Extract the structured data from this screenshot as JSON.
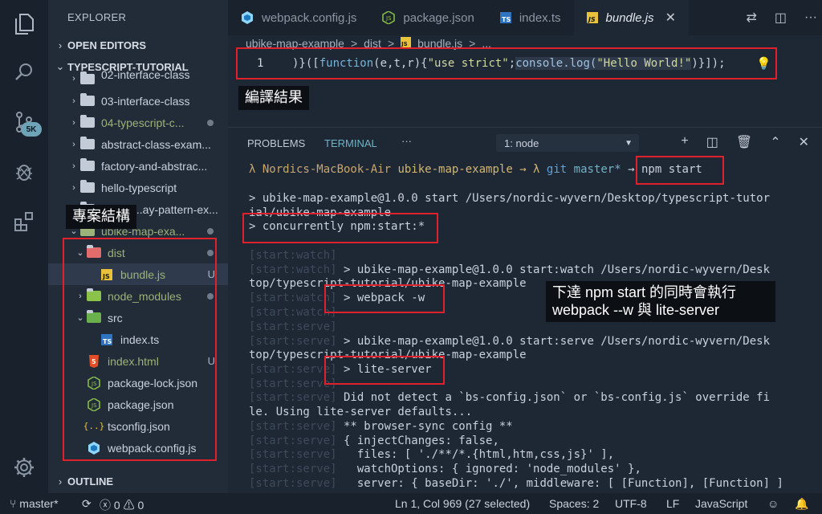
{
  "sidebar": {
    "title": "EXPLORER",
    "open_editors": "OPEN EDITORS",
    "project": "TYPESCRIPT-TUTORIAL",
    "outline": "OUTLINE",
    "items": [
      {
        "label": "02-interface-class"
      },
      {
        "label": "03-interface-class"
      },
      {
        "label": "04-typescript-c..."
      },
      {
        "label": "abstract-class-exam..."
      },
      {
        "label": "factory-and-abstrac..."
      },
      {
        "label": "hello-typescript"
      },
      {
        "label": "...ay-pattern-ex..."
      },
      {
        "label": "ubike-map-exa..."
      },
      {
        "label": "dist"
      },
      {
        "label": "bundle.js",
        "status": "U"
      },
      {
        "label": "node_modules"
      },
      {
        "label": "src"
      },
      {
        "label": "index.ts"
      },
      {
        "label": "index.html",
        "status": "U"
      },
      {
        "label": "package-lock.json"
      },
      {
        "label": "package.json"
      },
      {
        "label": "tsconfig.json"
      },
      {
        "label": "webpack.config.js"
      }
    ]
  },
  "activity": {
    "badge": "5K"
  },
  "tabs": [
    {
      "label": "webpack.config.js",
      "icon": "webpack-icon"
    },
    {
      "label": "package.json",
      "icon": "npm-icon"
    },
    {
      "label": "index.ts",
      "icon": "ts-icon"
    },
    {
      "label": "bundle.js",
      "icon": "js-icon"
    }
  ],
  "breadcrumb": {
    "folder": "ubike-map-example",
    "sep": ">",
    "dist": "dist",
    "file": "bundle.js",
    "more": "..."
  },
  "editor": {
    "line_number": "1",
    "code_prefix": ")}([",
    "code_kw": "function",
    "code_args": "(e,t,r){",
    "code_str": "\"use strict\"",
    "code_semi": ";",
    "code_console": "console.log(",
    "code_hello": "\"Hello World!\"",
    "code_tail": ")}]);"
  },
  "annotations": {
    "compile_result": "編譯結果",
    "project_structure": "專案結構",
    "npm_start_note_line1": "下達 npm start 的同時會執行",
    "npm_start_note_line2": "webpack --w 與 lite-server"
  },
  "panel": {
    "problems_tab": "PROBLEMS",
    "terminal_tab": "TERMINAL",
    "more": "···",
    "terminal_select": "1: node"
  },
  "terminal": {
    "prompt_host": "λ Nordics-MacBook-Air",
    "prompt_dir": "ubike-map-example",
    "prompt_arrow": "→ λ",
    "prompt_git": "git",
    "prompt_branch": "master*",
    "prompt_arrow2": "→",
    "prompt_cmd": "npm start",
    "lines": [
      {
        "prefix": "",
        "text": "> ubike-map-example@1.0.0 start /Users/nordic-wyvern/Desktop/typescript-tutor"
      },
      {
        "prefix": "",
        "text": "ial/ubike-map-example"
      },
      {
        "prefix": "",
        "text": "> concurrently npm:start:*"
      },
      {
        "prefix": "[start:watch]",
        "text": ""
      },
      {
        "prefix": "[start:watch]",
        "text": " > ubike-map-example@1.0.0 start:watch /Users/nordic-wyvern/Desk"
      },
      {
        "prefix": "",
        "text": "top/typescript-tutorial/ubike-map-example"
      },
      {
        "prefix": "[start:watch]",
        "text": " > webpack -w"
      },
      {
        "prefix": "[start:watch]",
        "text": ""
      },
      {
        "prefix": "[start:serve]",
        "text": ""
      },
      {
        "prefix": "[start:serve]",
        "text": " > ubike-map-example@1.0.0 start:serve /Users/nordic-wyvern/Desk"
      },
      {
        "prefix": "",
        "text": "top/typescript-tutorial/ubike-map-example"
      },
      {
        "prefix": "[start:serve]",
        "text": " > lite-server"
      },
      {
        "prefix": "[start:serve]",
        "text": ""
      },
      {
        "prefix": "[start:serve]",
        "text": " Did not detect a `bs-config.json` or `bs-config.js` override fi"
      },
      {
        "prefix": "",
        "text": "le. Using lite-server defaults..."
      },
      {
        "prefix": "[start:serve]",
        "text": " ** browser-sync config **"
      },
      {
        "prefix": "[start:serve]",
        "text": " { injectChanges: false,"
      },
      {
        "prefix": "[start:serve]",
        "text": "   files: [ './**/*.{html,htm,css,js}' ],"
      },
      {
        "prefix": "[start:serve]",
        "text": "   watchOptions: { ignored: 'node_modules' },"
      },
      {
        "prefix": "[start:serve]",
        "text": "   server: { baseDir: './', middleware: [ [Function], [Function] ]"
      }
    ]
  },
  "status": {
    "branch": "master*",
    "errors": "0",
    "warnings": "0",
    "position": "Ln 1, Col 969 (27 selected)",
    "spaces": "Spaces: 2",
    "encoding": "UTF-8",
    "eol": "LF",
    "language": "JavaScript"
  },
  "colors": {
    "accent_red": "#e0202a",
    "terminal_tab_active": "#6fb4c6",
    "git_modified": "#9bb27a",
    "bulb": "#f2c744"
  }
}
